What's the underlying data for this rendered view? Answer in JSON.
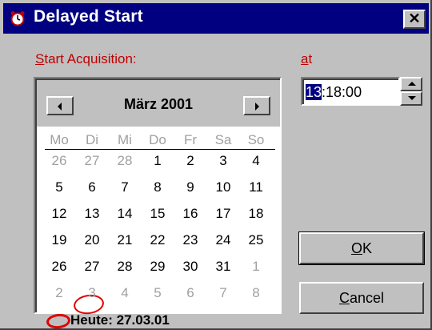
{
  "window": {
    "title": "Delayed Start",
    "close_glyph": "✕"
  },
  "labels": {
    "start_acquisition": "Start Acquisition:",
    "start_acquisition_access_key": "S",
    "start_acquisition_rest": "tart Acquisition:",
    "at": "at",
    "at_access_key": "a",
    "at_rest": "t"
  },
  "calendar": {
    "month_label": "März 2001",
    "weekdays": [
      "Mo",
      "Di",
      "Mi",
      "Do",
      "Fr",
      "Sa",
      "So"
    ],
    "weeks": [
      [
        "26",
        "27",
        "28",
        "1",
        "2",
        "3",
        "4"
      ],
      [
        "5",
        "6",
        "7",
        "8",
        "9",
        "10",
        "11"
      ],
      [
        "12",
        "13",
        "14",
        "15",
        "16",
        "17",
        "18"
      ],
      [
        "19",
        "20",
        "21",
        "22",
        "23",
        "24",
        "25"
      ],
      [
        "26",
        "27",
        "28",
        "29",
        "30",
        "31",
        "1"
      ],
      [
        "2",
        "3",
        "4",
        "5",
        "6",
        "7",
        "8"
      ]
    ],
    "today_label": "Heute: 27.03.01",
    "selected_day": "27"
  },
  "time": {
    "hour": "13",
    "rest": ":18:00"
  },
  "buttons": {
    "ok_access_key": "O",
    "ok_rest": "K",
    "cancel_access_key": "C",
    "cancel_rest": "ancel"
  },
  "colors": {
    "title_bar": "#000080",
    "dialog_face": "#c0c0c0",
    "label_red": "#c00000",
    "today_marker": "#e00000",
    "muted_day": "#a0a0a0"
  }
}
